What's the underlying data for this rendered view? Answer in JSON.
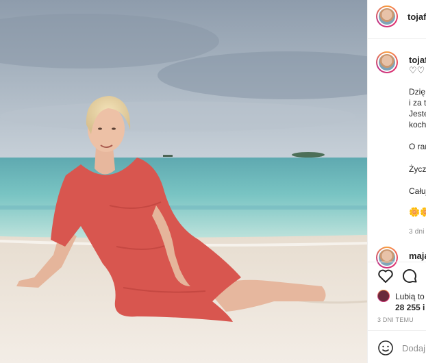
{
  "post": {
    "author": "tojafi",
    "caption_author": "tojaf",
    "caption_lines": [
      "Dzię",
      "i za t",
      "Jeste",
      "koch"
    ],
    "caption_line2": "O ran",
    "caption_line3": "Życz",
    "caption_line4": "Całuj",
    "emoji": "🌼🌼",
    "comment_time": "3 dni",
    "commenter": "maja",
    "liked_by_prefix": "Lubią to",
    "like_count": "28 255 i",
    "posted_time": "3 DNI TEMU",
    "add_comment_placeholder": "Dodaj"
  },
  "colors": {
    "sky": "#9aa7b5",
    "sea": "#7fc6c4",
    "sand": "#eee6dc",
    "dress": "#d9544d"
  },
  "icons": [
    "heart-icon",
    "comment-icon",
    "emoji-icon",
    "like-heart-icon"
  ]
}
